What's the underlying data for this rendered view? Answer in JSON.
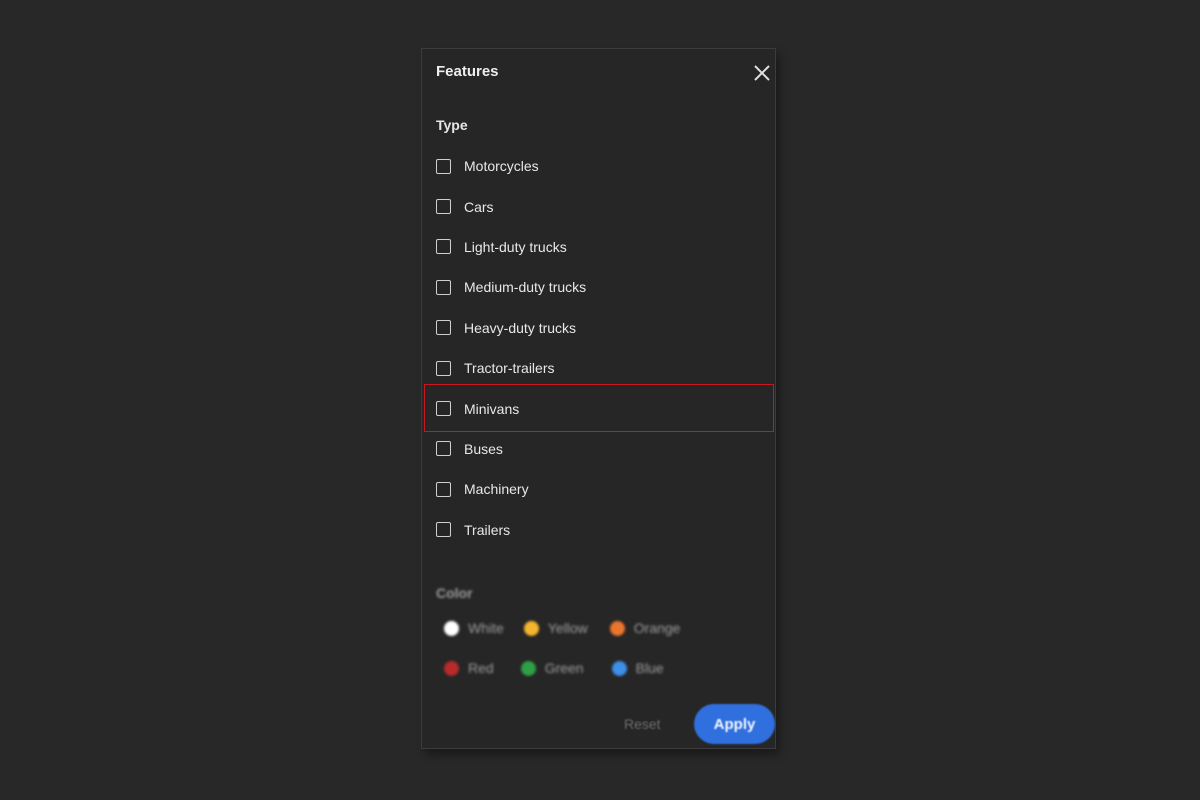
{
  "panel": {
    "title": "Features",
    "close_icon": "close-icon"
  },
  "type_section": {
    "title": "Type",
    "items": [
      {
        "label": "Motorcycles",
        "checked": false
      },
      {
        "label": "Cars",
        "checked": false
      },
      {
        "label": "Light-duty trucks",
        "checked": false
      },
      {
        "label": "Medium-duty trucks",
        "checked": false
      },
      {
        "label": "Heavy-duty trucks",
        "checked": false
      },
      {
        "label": "Tractor-trailers",
        "checked": false
      },
      {
        "label": "Minivans",
        "checked": false,
        "highlighted": true
      },
      {
        "label": "Buses",
        "checked": false
      },
      {
        "label": "Machinery",
        "checked": false
      },
      {
        "label": "Trailers",
        "checked": false
      }
    ]
  },
  "color_section": {
    "title": "Color",
    "options": [
      {
        "label": "White",
        "color": "#ffffff"
      },
      {
        "label": "Yellow",
        "color": "#f5b52e"
      },
      {
        "label": "Orange",
        "color": "#e8762e"
      },
      {
        "label": "Red",
        "color": "#b72b2b"
      },
      {
        "label": "Green",
        "color": "#2f9f45"
      },
      {
        "label": "Blue",
        "color": "#3d8fe8"
      }
    ]
  },
  "footer": {
    "reset_label": "Reset",
    "apply_label": "Apply"
  },
  "colors": {
    "page_background": "#282828",
    "panel_background": "#262626",
    "accent": "#2f6fde",
    "highlight_border": "#c8171e"
  }
}
